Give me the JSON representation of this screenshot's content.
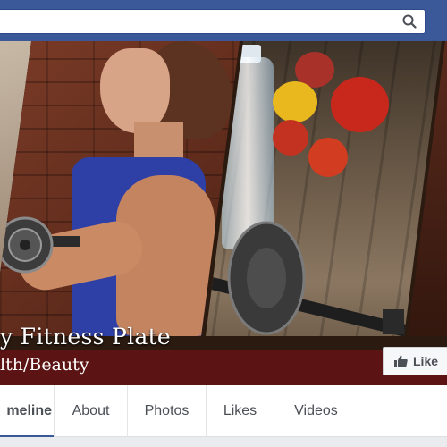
{
  "header": {
    "search_placeholder": "",
    "search_icon": "search-icon",
    "brand_color": "#3b5998"
  },
  "page": {
    "title": "y Fitness Plate",
    "category": "lth/Beauty"
  },
  "actions": {
    "like_label": "Like",
    "like_icon": "thumbs-up-icon"
  },
  "tabs": [
    {
      "label": "meline",
      "active": true
    },
    {
      "label": "About",
      "active": false
    },
    {
      "label": "Photos",
      "active": false
    },
    {
      "label": "Likes",
      "active": false
    },
    {
      "label": "Videos",
      "active": false
    }
  ],
  "colors": {
    "title_strip": "#5b1313",
    "tab_underline": "#3b5998"
  }
}
